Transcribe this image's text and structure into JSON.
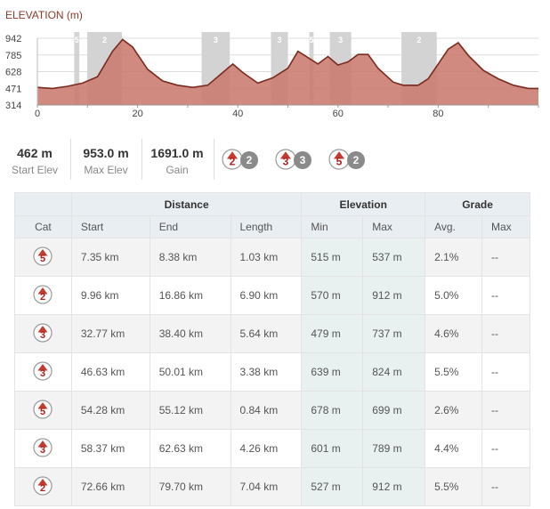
{
  "chart_data": {
    "type": "area",
    "title": "ELEVATION (m)",
    "yticks": [
      942,
      785,
      628,
      471,
      314
    ],
    "xticks": [
      0,
      20,
      40,
      60,
      80
    ],
    "xlim": [
      0,
      100
    ],
    "ylim": [
      314,
      942
    ],
    "profile": [
      [
        0,
        480
      ],
      [
        3,
        470
      ],
      [
        6,
        490
      ],
      [
        9,
        520
      ],
      [
        12,
        580
      ],
      [
        15,
        820
      ],
      [
        17,
        930
      ],
      [
        19,
        860
      ],
      [
        22,
        650
      ],
      [
        25,
        540
      ],
      [
        28,
        500
      ],
      [
        31,
        480
      ],
      [
        34,
        500
      ],
      [
        37,
        620
      ],
      [
        39,
        700
      ],
      [
        41,
        620
      ],
      [
        44,
        520
      ],
      [
        47,
        570
      ],
      [
        50,
        660
      ],
      [
        52,
        820
      ],
      [
        54,
        760
      ],
      [
        56,
        700
      ],
      [
        58,
        770
      ],
      [
        60,
        690
      ],
      [
        62,
        720
      ],
      [
        64,
        790
      ],
      [
        66,
        790
      ],
      [
        68,
        660
      ],
      [
        71,
        530
      ],
      [
        73,
        500
      ],
      [
        76,
        500
      ],
      [
        78,
        560
      ],
      [
        80,
        700
      ],
      [
        82,
        840
      ],
      [
        84,
        900
      ],
      [
        86,
        780
      ],
      [
        89,
        640
      ],
      [
        92,
        560
      ],
      [
        95,
        500
      ],
      [
        98,
        470
      ],
      [
        100,
        470
      ]
    ],
    "climb_bands": [
      {
        "start": 7.35,
        "end": 8.38,
        "cat": "5"
      },
      {
        "start": 9.96,
        "end": 16.86,
        "cat": "2"
      },
      {
        "start": 32.77,
        "end": 38.4,
        "cat": "3"
      },
      {
        "start": 46.63,
        "end": 50.01,
        "cat": "3"
      },
      {
        "start": 54.28,
        "end": 55.12,
        "cat": "5"
      },
      {
        "start": 58.37,
        "end": 62.63,
        "cat": "3"
      },
      {
        "start": 72.66,
        "end": 79.7,
        "cat": "2"
      }
    ],
    "colors": {
      "fill": "#c97a6e",
      "line": "#7a2a1e",
      "band": "#d3d3d3",
      "grid": "#dddddd"
    }
  },
  "stats": {
    "start_elev": "462 m",
    "start_elev_label": "Start Elev",
    "max_elev": "953.0 m",
    "max_elev_label": "Max Elev",
    "gain": "1691.0 m",
    "gain_label": "Gain"
  },
  "cat_counts": [
    {
      "cat": "2",
      "count": "2"
    },
    {
      "cat": "3",
      "count": "3"
    },
    {
      "cat": "5",
      "count": "2"
    }
  ],
  "table": {
    "groups": {
      "distance": "Distance",
      "elevation": "Elevation",
      "grade": "Grade"
    },
    "cols": {
      "cat": "Cat",
      "start": "Start",
      "end": "End",
      "length": "Length",
      "min": "Min",
      "max": "Max",
      "avg": "Avg.",
      "gmax": "Max"
    },
    "rows": [
      {
        "cat": "5",
        "start": "7.35 km",
        "end": "8.38 km",
        "length": "1.03 km",
        "min": "515 m",
        "max": "537 m",
        "avg": "2.1%",
        "gmax": "--"
      },
      {
        "cat": "2",
        "start": "9.96 km",
        "end": "16.86 km",
        "length": "6.90 km",
        "min": "570 m",
        "max": "912 m",
        "avg": "5.0%",
        "gmax": "--"
      },
      {
        "cat": "3",
        "start": "32.77 km",
        "end": "38.40 km",
        "length": "5.64 km",
        "min": "479 m",
        "max": "737 m",
        "avg": "4.6%",
        "gmax": "--"
      },
      {
        "cat": "3",
        "start": "46.63 km",
        "end": "50.01 km",
        "length": "3.38 km",
        "min": "639 m",
        "max": "824 m",
        "avg": "5.5%",
        "gmax": "--"
      },
      {
        "cat": "5",
        "start": "54.28 km",
        "end": "55.12 km",
        "length": "0.84 km",
        "min": "678 m",
        "max": "699 m",
        "avg": "2.6%",
        "gmax": "--"
      },
      {
        "cat": "3",
        "start": "58.37 km",
        "end": "62.63 km",
        "length": "4.26 km",
        "min": "601 m",
        "max": "789 m",
        "avg": "4.4%",
        "gmax": "--"
      },
      {
        "cat": "2",
        "start": "72.66 km",
        "end": "79.70 km",
        "length": "7.04 km",
        "min": "527 m",
        "max": "912 m",
        "avg": "5.5%",
        "gmax": "--"
      }
    ]
  }
}
